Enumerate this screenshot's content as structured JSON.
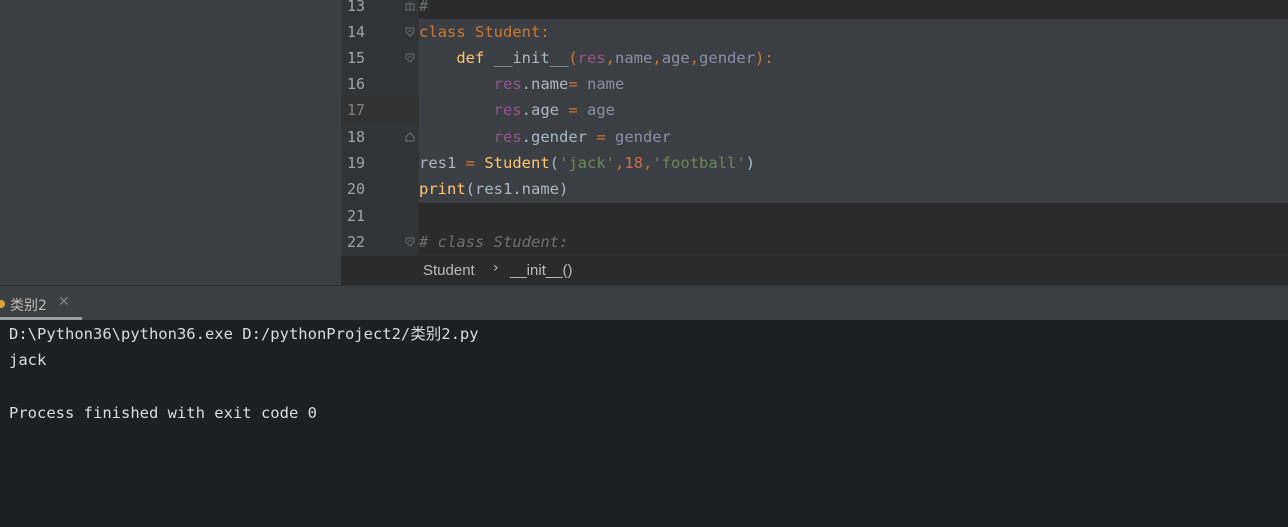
{
  "editor": {
    "lines": [
      {
        "num": "13"
      },
      {
        "num": "14"
      },
      {
        "num": "15"
      },
      {
        "num": "16"
      },
      {
        "num": "17"
      },
      {
        "num": "18"
      },
      {
        "num": "19"
      },
      {
        "num": "20"
      },
      {
        "num": "21"
      },
      {
        "num": "22"
      }
    ],
    "tokens": {
      "l13_comment": "#",
      "l14_kw": "class",
      "l14_name": " Student",
      "l14_colon": ":",
      "l15_def": "def",
      "l15_func": " __init__",
      "l15_open": "(",
      "l15_self": "res",
      "l15_c1": ",",
      "l15_p1": "name",
      "l15_c2": ",",
      "l15_p2": "age",
      "l15_c3": ",",
      "l15_p3": "gender",
      "l15_close": "):",
      "l16_self": "res",
      "l16_attr": ".name",
      "l16_eq": "= ",
      "l16_val": "name",
      "l17_self": "res",
      "l17_attr": ".age ",
      "l17_eq": "= ",
      "l17_val": "age",
      "l18_self": "res",
      "l18_attr": ".gender ",
      "l18_eq": "= ",
      "l18_val": "gender",
      "l19_var": "res1 ",
      "l19_eq": "= ",
      "l19_cls": "Student",
      "l19_open": "(",
      "l19_s1": "'jack'",
      "l19_c1": ",",
      "l19_n": "18",
      "l19_c2": ",",
      "l19_s2": "'football'",
      "l19_close": ")",
      "l20_print": "print",
      "l20_args": "(res1.name)",
      "l22_comment": "# class Student:"
    }
  },
  "breadcrumb": {
    "items": [
      "Student",
      "__init__()"
    ],
    "separator": "›"
  },
  "run_tab": {
    "label": "类别2",
    "close": "✕"
  },
  "console": {
    "lines": [
      "D:\\Python36\\python36.exe D:/pythonProject2/类别2.py",
      "jack",
      "",
      "Process finished with exit code 0"
    ]
  },
  "colors": {
    "keyword": "#cc7832",
    "class_name": "#ffc66d",
    "self": "#94558d",
    "string": "#6a8759",
    "number": "#cc6b53",
    "editor_bg": "#2b2b2b",
    "console_bg": "#1e1f21"
  }
}
